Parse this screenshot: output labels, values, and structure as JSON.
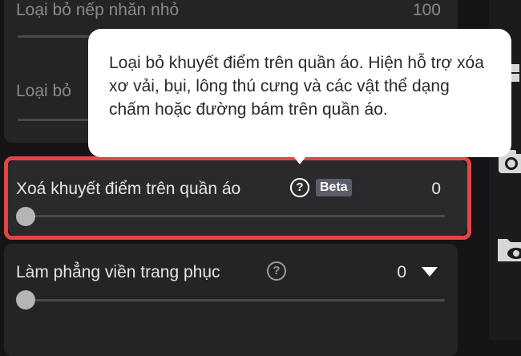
{
  "sliders": {
    "wrinkles": {
      "label": "Loại bỏ nếp nhăn nhỏ",
      "value": "100",
      "level": 1.0
    },
    "second": {
      "label": "Loại bỏ",
      "level": 1.0
    },
    "defects": {
      "label": "Xoá khuyết điểm trên quần áo",
      "value": "0",
      "badge": "Beta",
      "level": 0.0
    },
    "edges": {
      "label": "Làm phẳng viền trang phục",
      "value": "0",
      "level": 0.0
    }
  },
  "tooltip": {
    "text": "Loại bỏ khuyết điểm trên quần áo. Hiện hỗ trợ xóa xơ vải, bụi, lông thú cưng và các vật thể dạng chấm hoặc đường bám trên quần áo."
  },
  "icons": {
    "help": "question-circle-icon",
    "dropdown": "caret-down-icon",
    "camera": "camera-icon",
    "folder": "folder-eye-icon"
  },
  "colors": {
    "highlight": "#e34545",
    "background": "#141416",
    "panel": "#242426",
    "beta_badge": "#5a5e6a"
  }
}
